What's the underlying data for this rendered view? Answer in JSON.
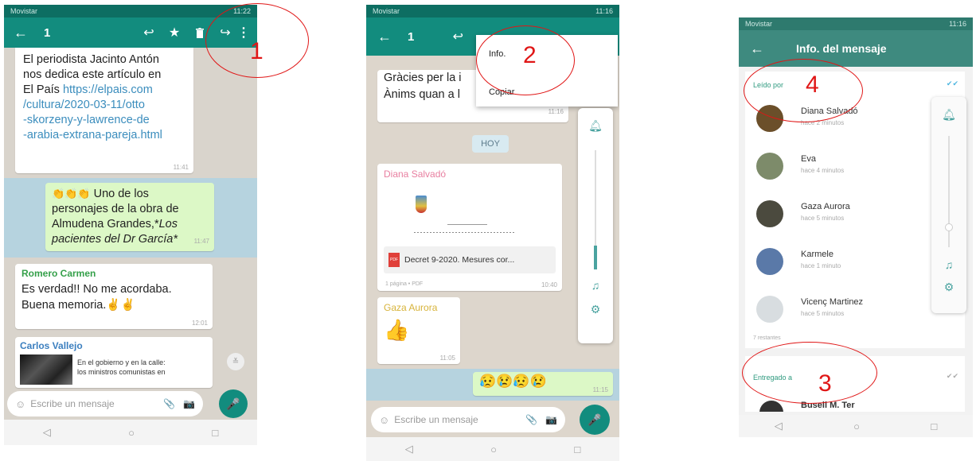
{
  "phone1": {
    "status_left": "Movistar",
    "status_right": "11:22",
    "selected_count": "1",
    "msg1_lines": [
      "El periodista Jacinto Antón",
      "nos dedica este artículo en",
      "El País "
    ],
    "msg1_link": "https://elpais.com/cultura/2020-03-11/otto-skorzeny-y-lawrence-de-arabia-extrana-pareja.html",
    "msg1_link_lines": [
      "https://elpais.com",
      "/cultura/2020-03-11/otto",
      "-skorzeny-y-lawrence-de",
      "-arabia-extrana-pareja.html"
    ],
    "msg1_time": "11:41",
    "msg2_emoji": "👏👏👏",
    "msg2_lines": [
      "Uno de los",
      "personajes de la obra de",
      "Almudena Grandes,*"
    ],
    "msg2_italic": [
      "Los",
      "pacientes del Dr García*"
    ],
    "msg2_time": "11:47",
    "msg3_sender": "Romero Carmen",
    "msg3_lines": [
      "Es verdad!! No me acordaba.",
      "Buena memoria."
    ],
    "msg3_emoji": "✌✌",
    "msg3_time": "12:01",
    "msg4_sender": "Carlos Vallejo",
    "msg4_preview_lines": [
      "En el gobierno y en la calle:",
      "los ministros comunistas en"
    ],
    "input_placeholder": "Escribe un mensaje"
  },
  "phone2": {
    "status_left": "Movistar",
    "status_right": "11:16",
    "selected_count": "1",
    "menu_info": "Info.",
    "menu_copy": "Copiar",
    "msg_top_lines": [
      "Gràcies per la i",
      "Ànims quan a l"
    ],
    "msg_top_time": "11:16",
    "day_label": "HOY",
    "msg_diana_sender": "Diana Salvadó",
    "doc_name": "Decret 9-2020. Mesures cor...",
    "doc_meta": "1 página • PDF",
    "doc_time": "10:40",
    "msg_gaza_sender": "Gaza Aurora",
    "msg_gaza_emoji": "👍",
    "msg_gaza_time": "11:05",
    "msg_out_emoji": "😥😢😥😢",
    "msg_out_time": "11:15",
    "input_placeholder": "Escribe un mensaje"
  },
  "phone3": {
    "status_left": "Movistar",
    "status_right": "11:16",
    "title": "Info. del mensaje",
    "read_by_label": "Leído por",
    "contacts": [
      {
        "name": "Diana Salvadó",
        "time": "hace 2 minutos",
        "color": "#6b4f2a"
      },
      {
        "name": "Eva",
        "time": "hace 4 minutos",
        "color": "#7d8b6a"
      },
      {
        "name": "Gaza Aurora",
        "time": "hace 5 minutos",
        "color": "#4b4a3e"
      },
      {
        "name": "Karmele",
        "time": "hace 1 minuto",
        "color": "#5a79a8"
      },
      {
        "name": "Vicenç Martinez",
        "time": "hace 5 minutos",
        "color": "#d8dde0"
      }
    ],
    "remaining": "7 restantes",
    "delivered_label": "Entregado a",
    "delivered_first": "Busell M. Ter"
  },
  "annotations": {
    "n1": "1",
    "n2": "2",
    "n3": "3",
    "n4": "4"
  },
  "colors": {
    "whatsapp_green": "#128c7e",
    "annotation_red": "#e01616",
    "link_blue": "#3b8dbd"
  }
}
